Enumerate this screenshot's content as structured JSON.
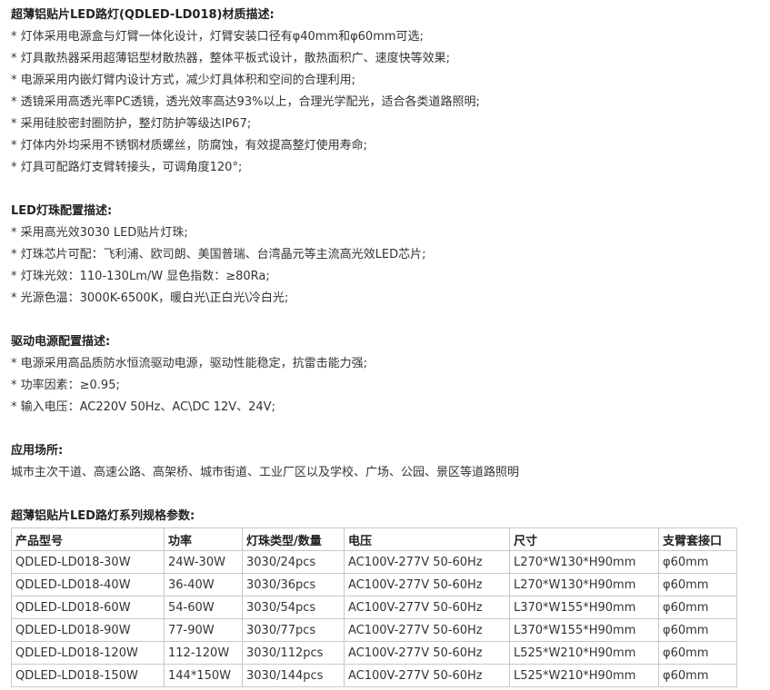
{
  "sections": [
    {
      "title": "超薄铝贴片LED路灯(QDLED-LD018)材质描述:",
      "lines": [
        "* 灯体采用电源盒与灯臂一体化设计，灯臂安装口径有φ40mm和φ60mm可选;",
        "* 灯具散热器采用超薄铝型材散热器，整体平板式设计，散热面积广、速度快等效果;",
        "* 电源采用内嵌灯臂内设计方式，减少灯具体积和空间的合理利用;",
        "* 透镜采用高透光率PC透镜，透光效率高达93%以上，合理光学配光，适合各类道路照明;",
        "* 采用硅胶密封圈防护，整灯防护等级达IP67;",
        "* 灯体内外均采用不锈钢材质螺丝，防腐蚀，有效提高整灯使用寿命;",
        "* 灯具可配路灯支臂转接头，可调角度120°;"
      ]
    },
    {
      "title": "LED灯珠配置描述:",
      "lines": [
        "* 采用高光效3030 LED贴片灯珠;",
        "* 灯珠芯片可配：飞利浦、欧司朗、美国普瑞、台湾晶元等主流高光效LED芯片;",
        "* 灯珠光效：110-130Lm/W 显色指数：≥80Ra;",
        "* 光源色温：3000K-6500K，暖白光\\正白光\\冷白光;"
      ]
    },
    {
      "title": "驱动电源配置描述:",
      "lines": [
        "* 电源采用高品质防水恒流驱动电源，驱动性能稳定，抗雷击能力强;",
        "* 功率因素：≥0.95;",
        "* 输入电压：AC220V 50Hz、AC\\DC 12V、24V;"
      ]
    },
    {
      "title": "应用场所:",
      "lines": [
        "城市主次干道、高速公路、高架桥、城市街道、工业厂区以及学校、广场、公园、景区等道路照明"
      ]
    }
  ],
  "table": {
    "title": "超薄铝贴片LED路灯系列规格参数:",
    "headers": [
      "产品型号",
      "功率",
      "灯珠类型/数量",
      "电压",
      "尺寸",
      "支臂套接口"
    ],
    "rows": [
      [
        "QDLED-LD018-30W",
        "24W-30W",
        "3030/24pcs",
        "AC100V-277V 50-60Hz",
        "L270*W130*H90mm",
        "φ60mm"
      ],
      [
        "QDLED-LD018-40W",
        "36-40W",
        "3030/36pcs",
        "AC100V-277V 50-60Hz",
        "L270*W130*H90mm",
        "φ60mm"
      ],
      [
        "QDLED-LD018-60W",
        "54-60W",
        "3030/54pcs",
        "AC100V-277V 50-60Hz",
        "L370*W155*H90mm",
        "φ60mm"
      ],
      [
        "QDLED-LD018-90W",
        "77-90W",
        "3030/77pcs",
        "AC100V-277V 50-60Hz",
        "L370*W155*H90mm",
        "φ60mm"
      ],
      [
        "QDLED-LD018-120W",
        "112-120W",
        "3030/112pcs",
        "AC100V-277V 50-60Hz",
        "L525*W210*H90mm",
        "φ60mm"
      ],
      [
        "QDLED-LD018-150W",
        "144*150W",
        "3030/144pcs",
        "AC100V-277V 50-60Hz",
        "L525*W210*H90mm",
        "φ60mm"
      ]
    ]
  }
}
